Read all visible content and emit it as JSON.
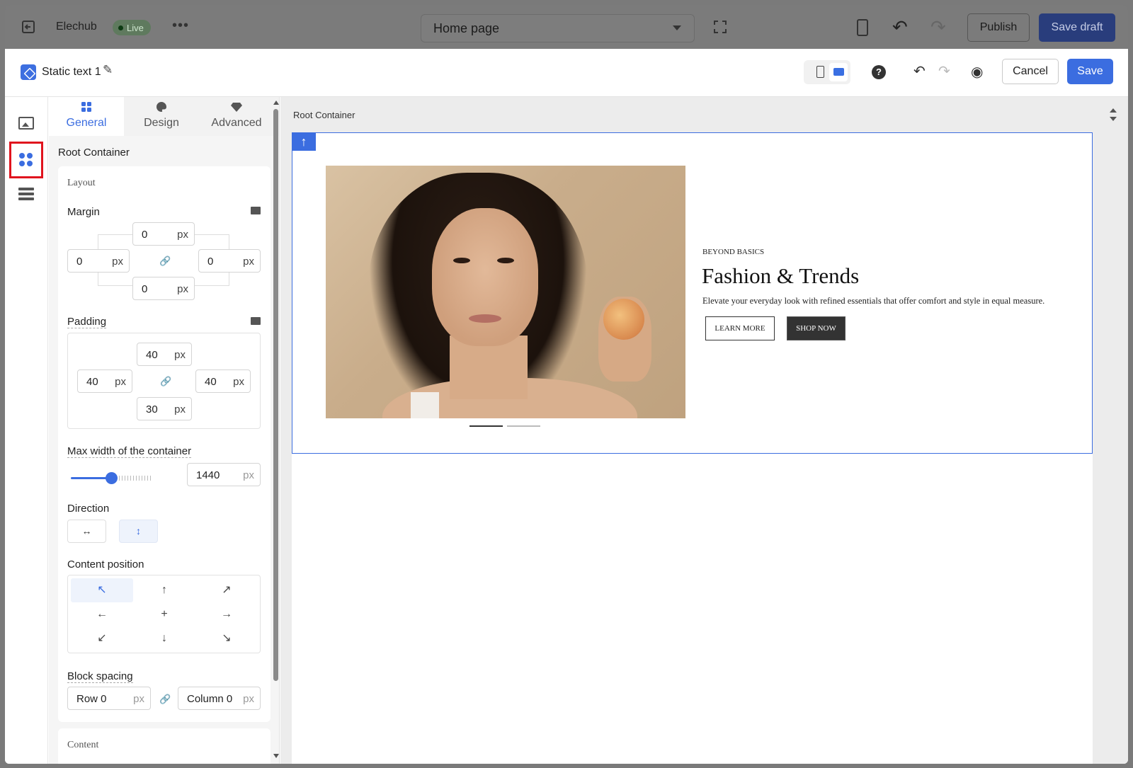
{
  "topbar": {
    "store_name": "Elechub",
    "live_badge": "Live",
    "more": "•••",
    "page_select": "Home page",
    "publish": "Publish",
    "save_draft": "Save draft"
  },
  "editor": {
    "element_title": "Static text 1",
    "cancel": "Cancel",
    "save": "Save",
    "help": "?"
  },
  "tabs": [
    {
      "label": "General"
    },
    {
      "label": "Design"
    },
    {
      "label": "Advanced"
    }
  ],
  "panel": {
    "title": "Root Container",
    "layout_heading": "Layout",
    "margin": {
      "label": "Margin",
      "top": "0",
      "left": "0",
      "right": "0",
      "bottom": "0",
      "unit": "px"
    },
    "padding": {
      "label": "Padding",
      "top": "40",
      "left": "40",
      "right": "40",
      "bottom": "30",
      "unit": "px"
    },
    "max_width": {
      "label": "Max width of the container",
      "value": "1440",
      "unit": "px",
      "slider_fraction": 0.5
    },
    "direction": {
      "label": "Direction",
      "horizontal": "↔",
      "vertical": "↕",
      "selected": "vertical"
    },
    "content_position": {
      "label": "Content position",
      "cells": [
        "↖",
        "↑",
        "↗",
        "←",
        "+",
        "→",
        "↙",
        "↓",
        "↘"
      ],
      "selected": "top-left"
    },
    "block_spacing": {
      "label": "Block spacing",
      "row": "Row 0",
      "column": "Column 0",
      "unit": "px"
    },
    "content_heading": "Content"
  },
  "canvas": {
    "breadcrumb": "Root Container",
    "hero": {
      "eyebrow": "BEYOND BASICS",
      "headline": "Fashion & Trends",
      "description": "Elevate your everyday look with refined essentials that offer comfort and style in equal measure.",
      "learn_more": "LEARN MORE",
      "shop_now": "SHOP NOW"
    }
  },
  "colors": {
    "accent": "#3b6de0",
    "selection": "#e0141e",
    "dark_button": "#333333"
  }
}
